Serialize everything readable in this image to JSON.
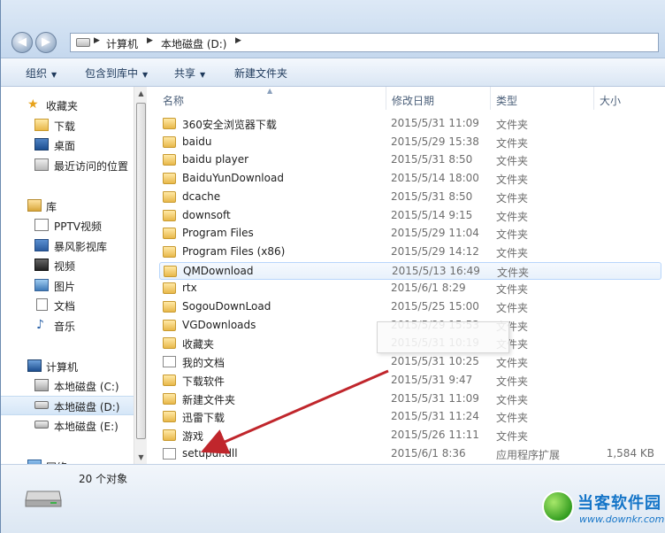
{
  "window": {
    "breadcrumbs": [
      "计算机",
      "本地磁盘 (D:)"
    ]
  },
  "toolbar": {
    "organize_label": "组织",
    "include_label": "包含到库中",
    "share_label": "共享",
    "newfolder_label": "新建文件夹"
  },
  "sidebar": {
    "favorites_header": "收藏夹",
    "favorites": [
      "下载",
      "桌面",
      "最近访问的位置"
    ],
    "libraries_header": "库",
    "libraries": [
      "PPTV视频",
      "暴风影视库",
      "视频",
      "图片",
      "文档",
      "音乐"
    ],
    "computer_header": "计算机",
    "drives": [
      "本地磁盘 (C:)",
      "本地磁盘 (D:)",
      "本地磁盘 (E:)"
    ],
    "network_header": "网络",
    "selected_drive_index": 1
  },
  "columns": {
    "name": "名称",
    "date": "修改日期",
    "type": "类型",
    "size": "大小"
  },
  "files": [
    {
      "name": "360安全浏览器下载",
      "date": "2015/5/31 11:09",
      "type": "文件夹",
      "size": "",
      "icon": "folder-icon"
    },
    {
      "name": "baidu",
      "date": "2015/5/29 15:38",
      "type": "文件夹",
      "size": "",
      "icon": "folder-icon"
    },
    {
      "name": "baidu player",
      "date": "2015/5/31 8:50",
      "type": "文件夹",
      "size": "",
      "icon": "folder-icon"
    },
    {
      "name": "BaiduYunDownload",
      "date": "2015/5/14 18:00",
      "type": "文件夹",
      "size": "",
      "icon": "folder-icon"
    },
    {
      "name": "dcache",
      "date": "2015/5/31 8:50",
      "type": "文件夹",
      "size": "",
      "icon": "folder-icon"
    },
    {
      "name": "downsoft",
      "date": "2015/5/14 9:15",
      "type": "文件夹",
      "size": "",
      "icon": "folder-icon"
    },
    {
      "name": "Program Files",
      "date": "2015/5/29 11:04",
      "type": "文件夹",
      "size": "",
      "icon": "folder-icon"
    },
    {
      "name": "Program Files (x86)",
      "date": "2015/5/29 14:12",
      "type": "文件夹",
      "size": "",
      "icon": "folder-icon"
    },
    {
      "name": "QMDownload",
      "date": "2015/5/13 16:49",
      "type": "文件夹",
      "size": "",
      "icon": "folder-icon"
    },
    {
      "name": "rtx",
      "date": "2015/6/1 8:29",
      "type": "文件夹",
      "size": "",
      "icon": "folder-icon"
    },
    {
      "name": "SogouDownLoad",
      "date": "2015/5/25 15:00",
      "type": "文件夹",
      "size": "",
      "icon": "folder-icon"
    },
    {
      "name": "VGDownloads",
      "date": "2015/5/29 15:53",
      "type": "文件夹",
      "size": "",
      "icon": "folder-icon"
    },
    {
      "name": "收藏夹",
      "date": "2015/5/31 10:19",
      "type": "文件夹",
      "size": "",
      "icon": "folder-icon"
    },
    {
      "name": "我的文档",
      "date": "2015/5/31 10:25",
      "type": "文件夹",
      "size": "",
      "icon": "doc-folder-icon"
    },
    {
      "name": "下载软件",
      "date": "2015/5/31 9:47",
      "type": "文件夹",
      "size": "",
      "icon": "folder-icon"
    },
    {
      "name": "新建文件夹",
      "date": "2015/5/31 11:09",
      "type": "文件夹",
      "size": "",
      "icon": "folder-icon"
    },
    {
      "name": "迅雷下载",
      "date": "2015/5/31 11:24",
      "type": "文件夹",
      "size": "",
      "icon": "folder-icon"
    },
    {
      "name": "游戏",
      "date": "2015/5/26 11:11",
      "type": "文件夹",
      "size": "",
      "icon": "folder-icon"
    },
    {
      "name": "setupui.dll",
      "date": "2015/6/1 8:36",
      "type": "应用程序扩展",
      "size": "1,584 KB",
      "icon": "dll-file-icon"
    }
  ],
  "hover_row_index": 8,
  "status": {
    "count_text": "20 个对象"
  },
  "watermark": {
    "title": "当客软件园",
    "url": "www.downkr.com"
  },
  "colors": {
    "accent": "#1e395b",
    "arrow": "#c0262c",
    "watermark": "#1575c8"
  }
}
